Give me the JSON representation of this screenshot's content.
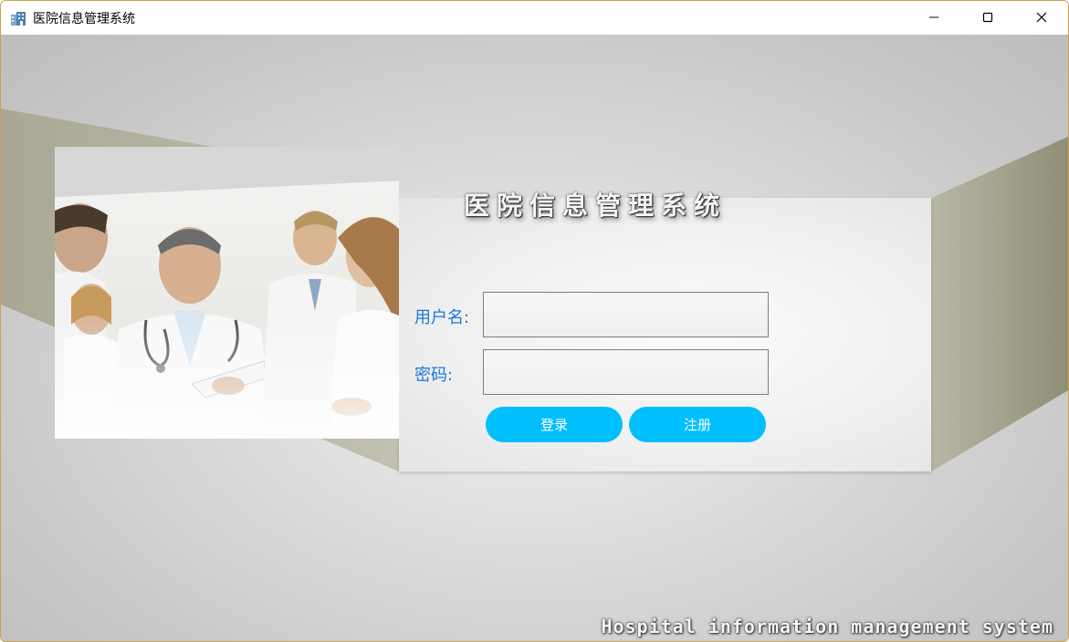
{
  "window": {
    "title": "医院信息管理系统",
    "icon": "hospital-building-icon"
  },
  "controls": {
    "minimize_icon": "minimize-icon",
    "maximize_icon": "maximize-icon",
    "close_icon": "close-icon"
  },
  "login": {
    "heading": "医院信息管理系统",
    "username_label": "用户名:",
    "username_value": "",
    "password_label": "密码:",
    "password_value": "",
    "login_button": "登录",
    "register_button": "注册"
  },
  "footer": {
    "tagline": "Hospital information management system"
  },
  "colors": {
    "accent": "#00bfff",
    "label": "#1a78d8",
    "window_border": "#c9a24c"
  }
}
